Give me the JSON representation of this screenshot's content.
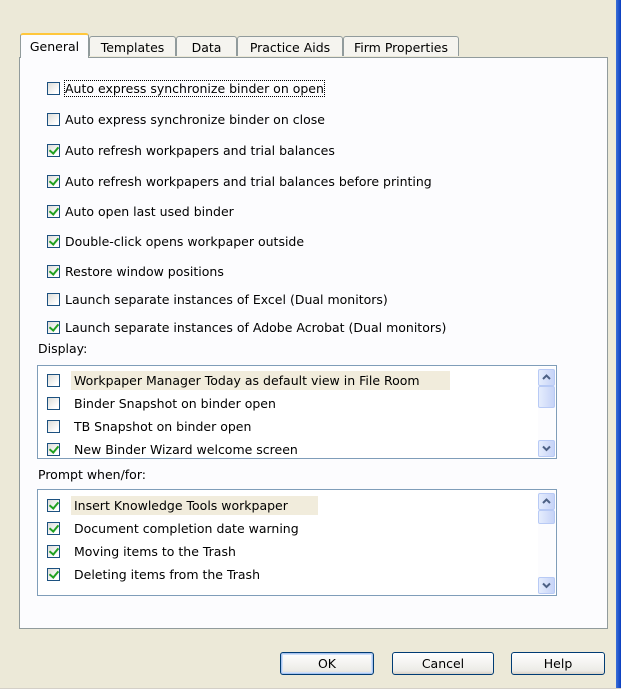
{
  "tabs": [
    {
      "label": "General",
      "active": true
    },
    {
      "label": "Templates",
      "active": false
    },
    {
      "label": "Data",
      "active": false
    },
    {
      "label": "Practice Aids",
      "active": false
    },
    {
      "label": "Firm Properties",
      "active": false
    }
  ],
  "options": [
    {
      "label": "Auto express synchronize binder on open",
      "checked": false
    },
    {
      "label": "Auto express synchronize binder on close",
      "checked": false
    },
    {
      "label": "Auto refresh workpapers and trial balances",
      "checked": true
    },
    {
      "label": "Auto refresh workpapers and trial balances before printing",
      "checked": true
    },
    {
      "label": "Auto open last used binder",
      "checked": true
    },
    {
      "label": "Double-click opens workpaper outside",
      "checked": true
    },
    {
      "label": "Restore window positions",
      "checked": true
    },
    {
      "label": "Launch separate instances of Excel (Dual monitors)",
      "checked": false
    },
    {
      "label": "Launch separate instances of Adobe Acrobat (Dual monitors)",
      "checked": true
    }
  ],
  "display": {
    "label": "Display:",
    "items": [
      {
        "label": "Workpaper Manager Today as default view in File Room",
        "checked": false
      },
      {
        "label": "Binder Snapshot on binder open",
        "checked": false
      },
      {
        "label": "TB Snapshot on binder open",
        "checked": false
      },
      {
        "label": "New Binder Wizard welcome screen",
        "checked": true
      }
    ]
  },
  "prompt": {
    "label": "Prompt when/for:",
    "items": [
      {
        "label": "Insert Knowledge Tools workpaper",
        "checked": true
      },
      {
        "label": "Document completion date warning",
        "checked": true
      },
      {
        "label": "Moving items to the Trash",
        "checked": true
      },
      {
        "label": "Deleting items from the Trash",
        "checked": true
      }
    ]
  },
  "buttons": {
    "ok": "OK",
    "cancel": "Cancel",
    "help": "Help"
  },
  "colors": {
    "dialog_bg": "#ece9d8",
    "panel_bg": "#fcfcfe",
    "check_green": "#21a121",
    "active_tab_accent": "#ffc73c",
    "highlight_row": "#f1ecdc"
  }
}
